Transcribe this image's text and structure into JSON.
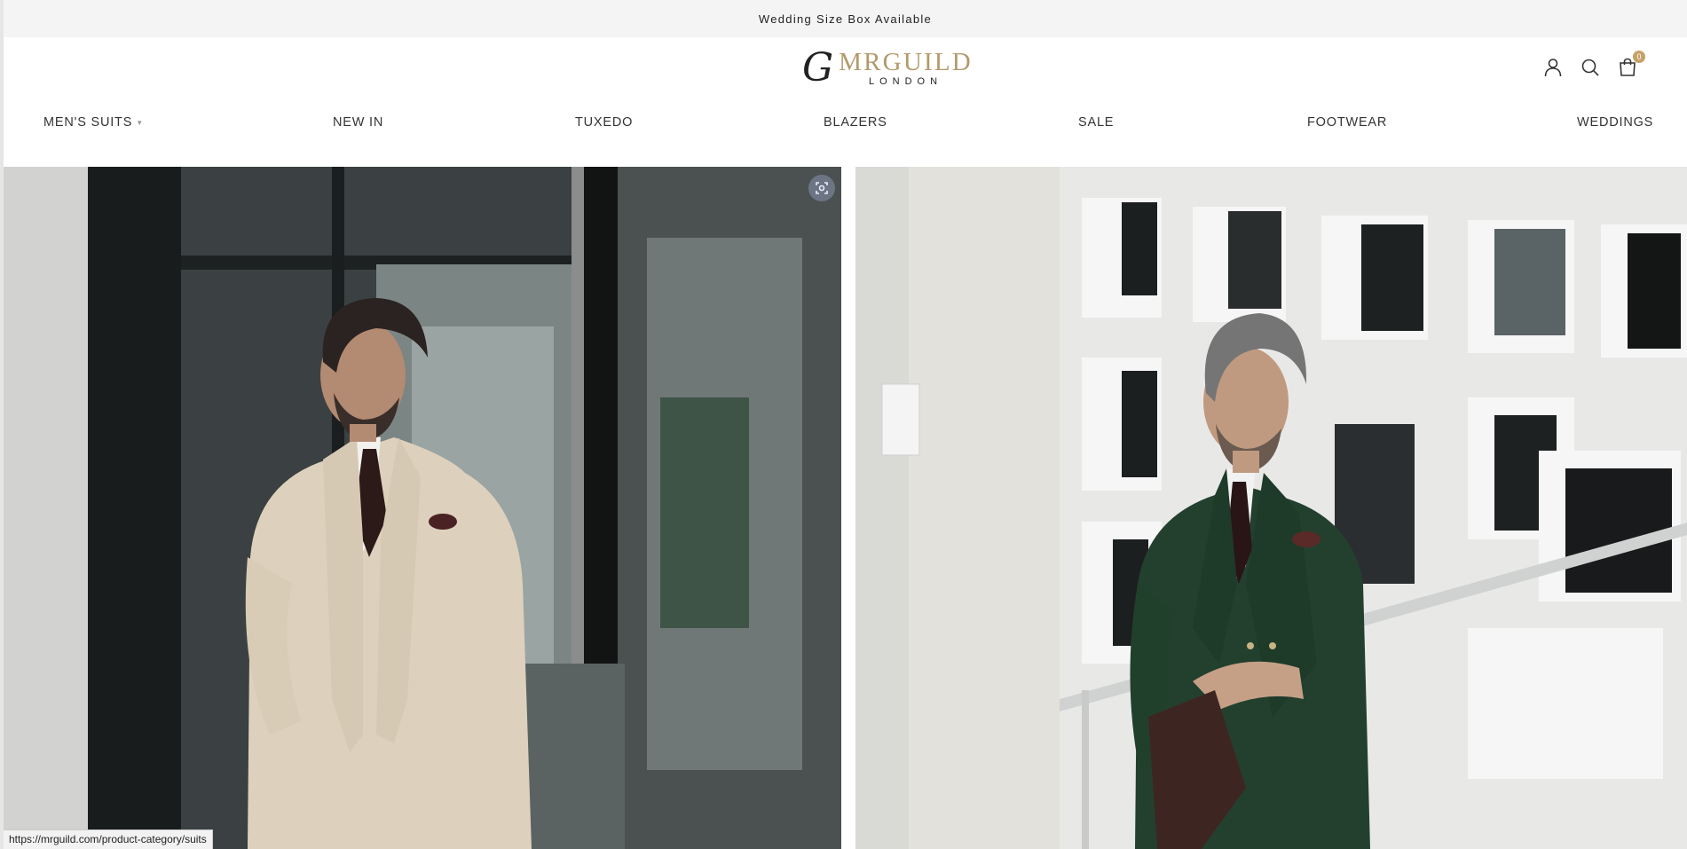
{
  "announcement": "Wedding Size Box Available",
  "brand": {
    "monogram": "G",
    "name": "MRGUILD",
    "location": "LONDON",
    "gold": "#b39a6b"
  },
  "header_icons": {
    "account": "user-icon",
    "search": "search-icon",
    "cart": "bag-icon",
    "cart_count": "0",
    "badge_color": "#c6a26a"
  },
  "nav": {
    "items": [
      "MEN'S SUITS",
      "NEW IN",
      "TUXEDO",
      "BLAZERS",
      "SALE",
      "FOOTWEAR",
      "WEDDINGS"
    ],
    "has_dropdown": [
      true,
      false,
      false,
      false,
      false,
      false,
      false
    ]
  },
  "hero": {
    "left": {
      "subject": "model in cream pinstripe three-piece suit",
      "lens_icon": "visual-search-icon"
    },
    "right": {
      "subject": "model in green pinstripe double-breasted suit"
    }
  },
  "status_bar": {
    "url": "https://mrguild.com/product-category/suits"
  }
}
